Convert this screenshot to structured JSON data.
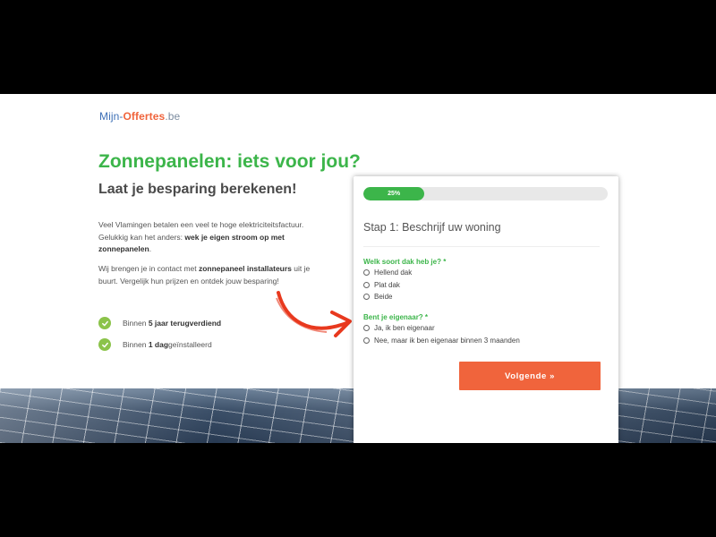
{
  "logo": {
    "part1": "Mijn-",
    "part2": "Offertes",
    "part3": ".be"
  },
  "hero": {
    "headline": "Zonnepanelen: iets voor jou?",
    "subhead": "Laat je besparing berekenen!",
    "para1_a": "Veel Vlamingen betalen een veel te hoge elektriciteitsfactuur. Gelukkig kan het anders: ",
    "para1_b": "wek je eigen stroom op met zonnepanelen",
    "para1_c": ".",
    "para2_a": "Wij brengen je in contact met ",
    "para2_b": "zonnepaneel installateurs",
    "para2_c": " uit je buurt. Vergelijk hun prijzen en ontdek jouw besparing!"
  },
  "benefits": [
    {
      "pre": "Binnen ",
      "bold": "5 jaar terugverdiend",
      "post": ""
    },
    {
      "pre": "Binnen ",
      "bold": "1 dag",
      "post": " geïnstalleerd"
    }
  ],
  "form": {
    "progress_label": "25%",
    "progress_value": 0.25,
    "step_title": "Stap 1: Beschrijf uw woning",
    "q1_label": "Welk soort dak heb je? *",
    "q1_options": [
      "Hellend dak",
      "Plat dak",
      "Beide"
    ],
    "q2_label": "Bent je eigenaar? *",
    "q2_options": [
      "Ja, ik ben eigenaar",
      "Nee, maar ik ben eigenaar binnen 3 maanden"
    ],
    "next_button": "Volgende »"
  },
  "colors": {
    "green": "#3cb54a",
    "orange": "#f0643c",
    "blue": "#3d6fb6"
  }
}
